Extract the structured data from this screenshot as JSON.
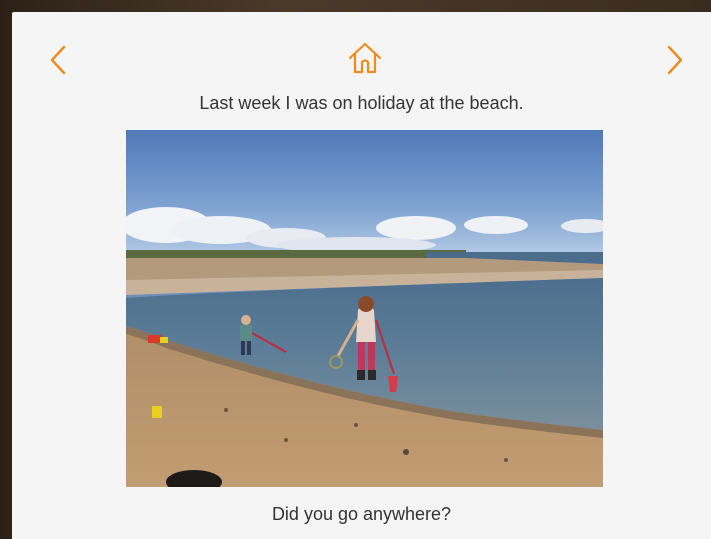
{
  "nav": {
    "back_icon": "chevron-left-icon",
    "home_icon": "home-icon",
    "forward_icon": "chevron-right-icon"
  },
  "page": {
    "text_top": "Last week I was on holiday at the beach.",
    "text_bottom": "Did you go anywhere?"
  },
  "colors": {
    "accent": "#f08a1c",
    "text": "#333333",
    "background": "#f5f5f5"
  }
}
